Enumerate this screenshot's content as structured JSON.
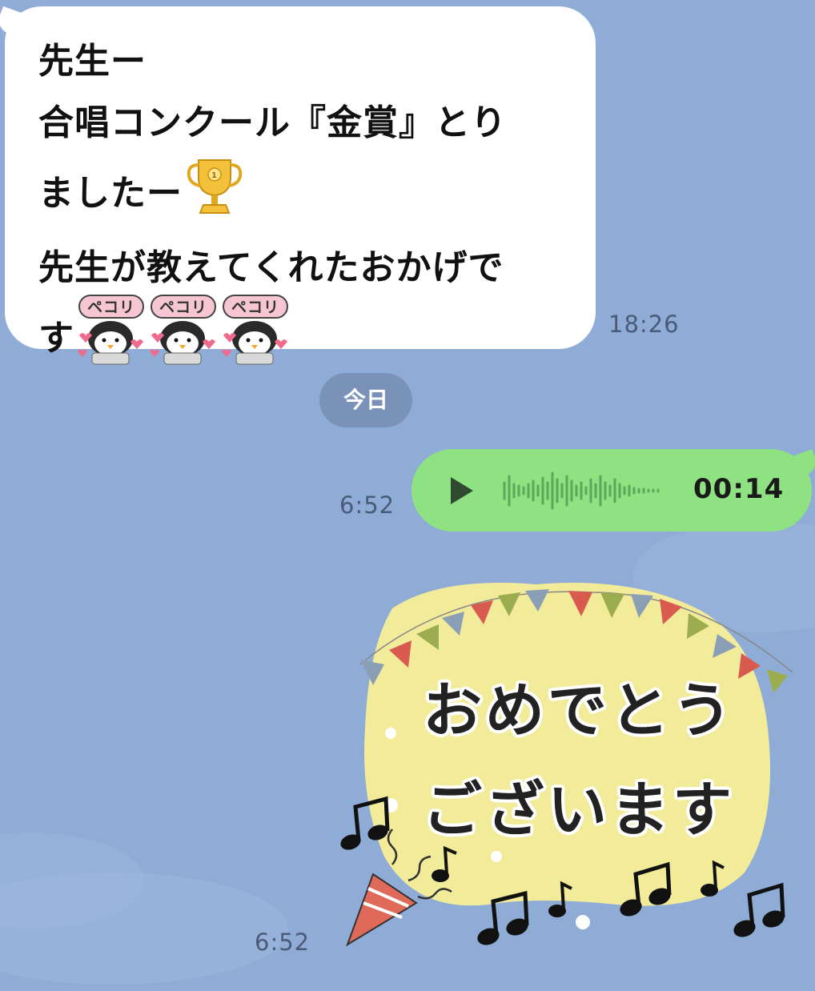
{
  "conversation": {
    "incoming_message": {
      "lines": [
        "先生ー",
        "合唱コンクール『金賞』とり",
        "ましたー",
        "先生が教えてくれたおかげで",
        "す"
      ],
      "sticker_label": "ペコリ",
      "time": "18:26"
    },
    "date_separator": "今日",
    "voice_message": {
      "duration": "00:14",
      "time": "6:52"
    },
    "sticker_message": {
      "line1": "おめでとう",
      "line2": "ございます",
      "time": "6:52"
    }
  },
  "colors": {
    "background": "#8facd6",
    "incoming_bubble": "#ffffff",
    "outgoing_bubble": "#8ee282",
    "date_chip": "#7b92b8"
  },
  "icons": [
    "trophy-icon",
    "penguin-bow-emoji",
    "play-icon",
    "waveform-icon",
    "party-popper-icon",
    "music-note-icon"
  ]
}
